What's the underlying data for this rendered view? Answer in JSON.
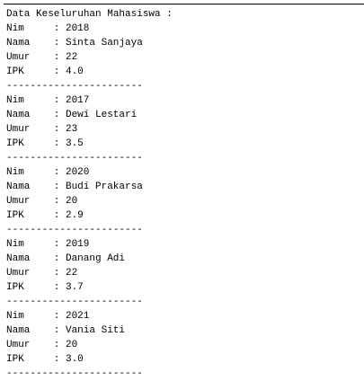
{
  "console": {
    "header": "Data Keseluruhan Mahasiswa :",
    "labels": {
      "nim": "Nim",
      "nama": "Nama",
      "umur": "Umur",
      "ipk": "IPK"
    },
    "separator": ":",
    "divider": "-----------------------",
    "records": [
      {
        "nim": "2018",
        "nama": "Sinta Sanjaya",
        "umur": "22",
        "ipk": "4.0"
      },
      {
        "nim": "2017",
        "nama": "Dewi Lestari",
        "umur": "23",
        "ipk": "3.5"
      },
      {
        "nim": "2020",
        "nama": "Budi Prakarsa",
        "umur": "20",
        "ipk": "2.9"
      },
      {
        "nim": "2019",
        "nama": "Danang Adi",
        "umur": "22",
        "ipk": "3.7"
      },
      {
        "nim": "2021",
        "nama": "Vania Siti",
        "umur": "20",
        "ipk": "3.0"
      }
    ]
  }
}
